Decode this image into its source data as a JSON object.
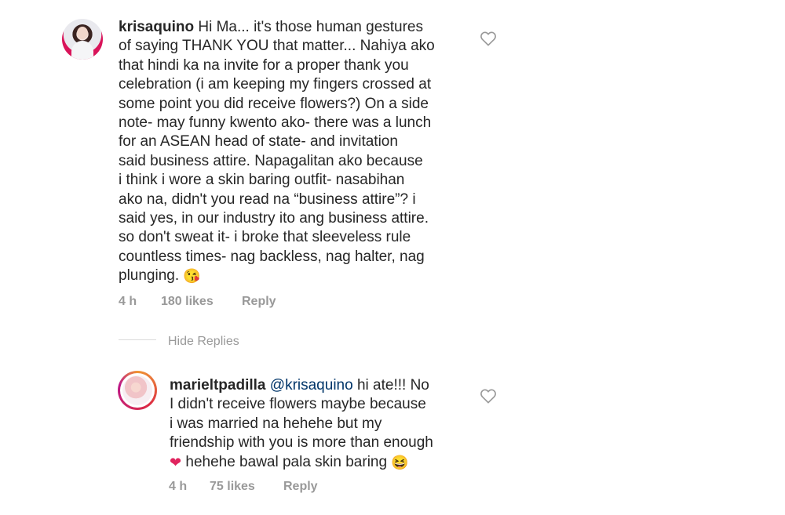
{
  "comment": {
    "username": "krisaquino",
    "lines": [
      "Hi Ma... it's those human gestures",
      "of saying THANK YOU that matter... Nahiya ako",
      "that hindi ka na invite for a proper thank you",
      "celebration (i am keeping my fingers crossed at",
      "some point you did receive flowers?) On a side",
      "note- may funny kwento ako- there was a lunch",
      "for an ASEAN head of state- and invitation",
      "said business attire. Napagalitan ako because",
      "i think i wore a skin baring outfit- nasabihan",
      "ako na, didn't you read na “business attire”? i",
      "said yes, in our industry ito ang business attire.",
      "so don't sweat it- i broke that sleeveless rule",
      "countless times- nag backless, nag halter, nag",
      "plunging."
    ],
    "emoji": "😘",
    "time": "4 h",
    "likes": "180 likes",
    "reply_label": "Reply",
    "like_icon": "heart-outline"
  },
  "hide_replies": "Hide Replies",
  "reply": {
    "username": "marieltpadilla",
    "mention": "@krisaquino",
    "lines": [
      "hi ate!!! No",
      "I didn't receive flowers maybe because",
      "i was married na hehehe but my",
      "friendship with you is more than enough",
      "hehehe bawal pala skin baring"
    ],
    "heart_emoji": "❤",
    "laugh_emoji": "😆",
    "time": "4 h",
    "likes": "75 likes",
    "reply_label": "Reply",
    "like_icon": "heart-outline"
  },
  "colors": {
    "text": "#262626",
    "secondary": "#999999",
    "mention": "#003569",
    "divider": "#dbdbdb"
  }
}
